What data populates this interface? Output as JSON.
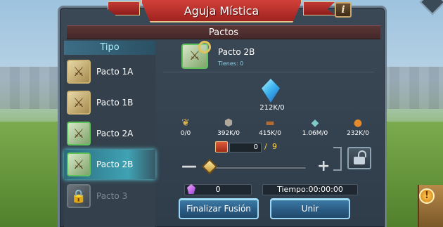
{
  "title": "Aguja Mística",
  "info_label": "i",
  "section_title": "Pactos",
  "list_header": "Tipo",
  "pacts": [
    {
      "label": "Pacto 1A",
      "icon": "scroll-sword-icon",
      "state": "normal"
    },
    {
      "label": "Pacto 1B",
      "icon": "scroll-sword-icon",
      "state": "normal"
    },
    {
      "label": "Pacto 2A",
      "icon": "scroll-sword-icon",
      "state": "normal"
    },
    {
      "label": "Pacto 2B",
      "icon": "scroll-sword-icon",
      "state": "selected"
    },
    {
      "label": "Pacto 3",
      "icon": "lock-icon",
      "state": "locked"
    }
  ],
  "selected": {
    "name": "Pacto 2B",
    "owned": "Tienes: 0"
  },
  "cost": {
    "crystal": "212K/0",
    "resources": [
      {
        "icon": "wheat-icon",
        "value": "0/0"
      },
      {
        "icon": "stone-icon",
        "value": "392K/0"
      },
      {
        "icon": "wood-icon",
        "value": "415K/0"
      },
      {
        "icon": "ore-icon",
        "value": "1.06M/0"
      },
      {
        "icon": "gold-icon",
        "value": "232K/0"
      }
    ]
  },
  "quantity": {
    "current": "0",
    "slash": "/",
    "max": "9"
  },
  "slider_value": 0,
  "gems": "0",
  "time": "Tiempo:00:00:00",
  "buttons": {
    "finalize": "Finalizar Fusión",
    "join": "Unir"
  },
  "minus_label": "—",
  "plus_label": "+",
  "badge_label": "!"
}
